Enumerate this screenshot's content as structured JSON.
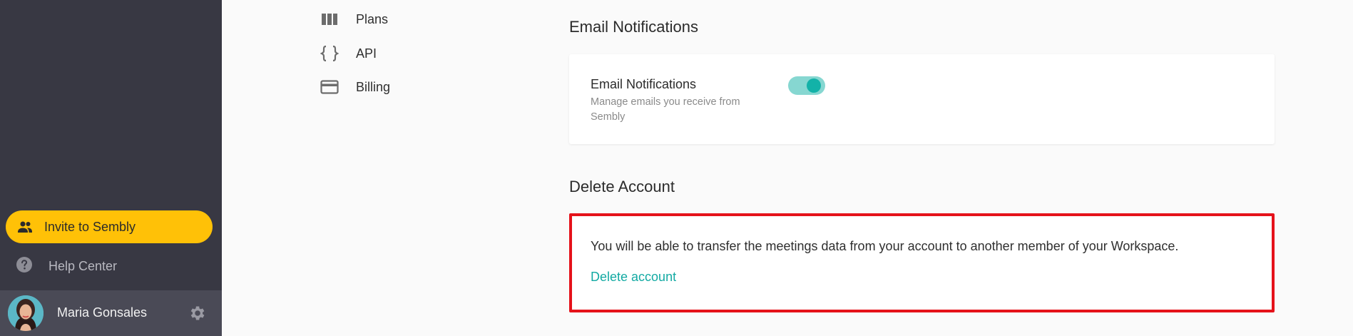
{
  "sidebar": {
    "invite_label": "Invite to Sembly",
    "help_label": "Help Center",
    "user_name": "Maria Gonsales",
    "accent_color": "#ffc107"
  },
  "settings_nav": {
    "items": [
      {
        "label": "Plans",
        "icon": "plans-columns-icon"
      },
      {
        "label": "API",
        "icon": "curly-braces-icon"
      },
      {
        "label": "Billing",
        "icon": "credit-card-icon"
      }
    ]
  },
  "email_section": {
    "title": "Email Notifications",
    "setting_title": "Email Notifications",
    "setting_description": "Manage emails you receive from Sembly",
    "toggle_on": true,
    "toggle_color": "#13b2a8"
  },
  "delete_section": {
    "title": "Delete Account",
    "description": "You will be able to transfer the meetings data from your account to another member of your Workspace.",
    "link_label": "Delete account",
    "highlight_color": "#e5121a",
    "link_color": "#13aaa3"
  }
}
